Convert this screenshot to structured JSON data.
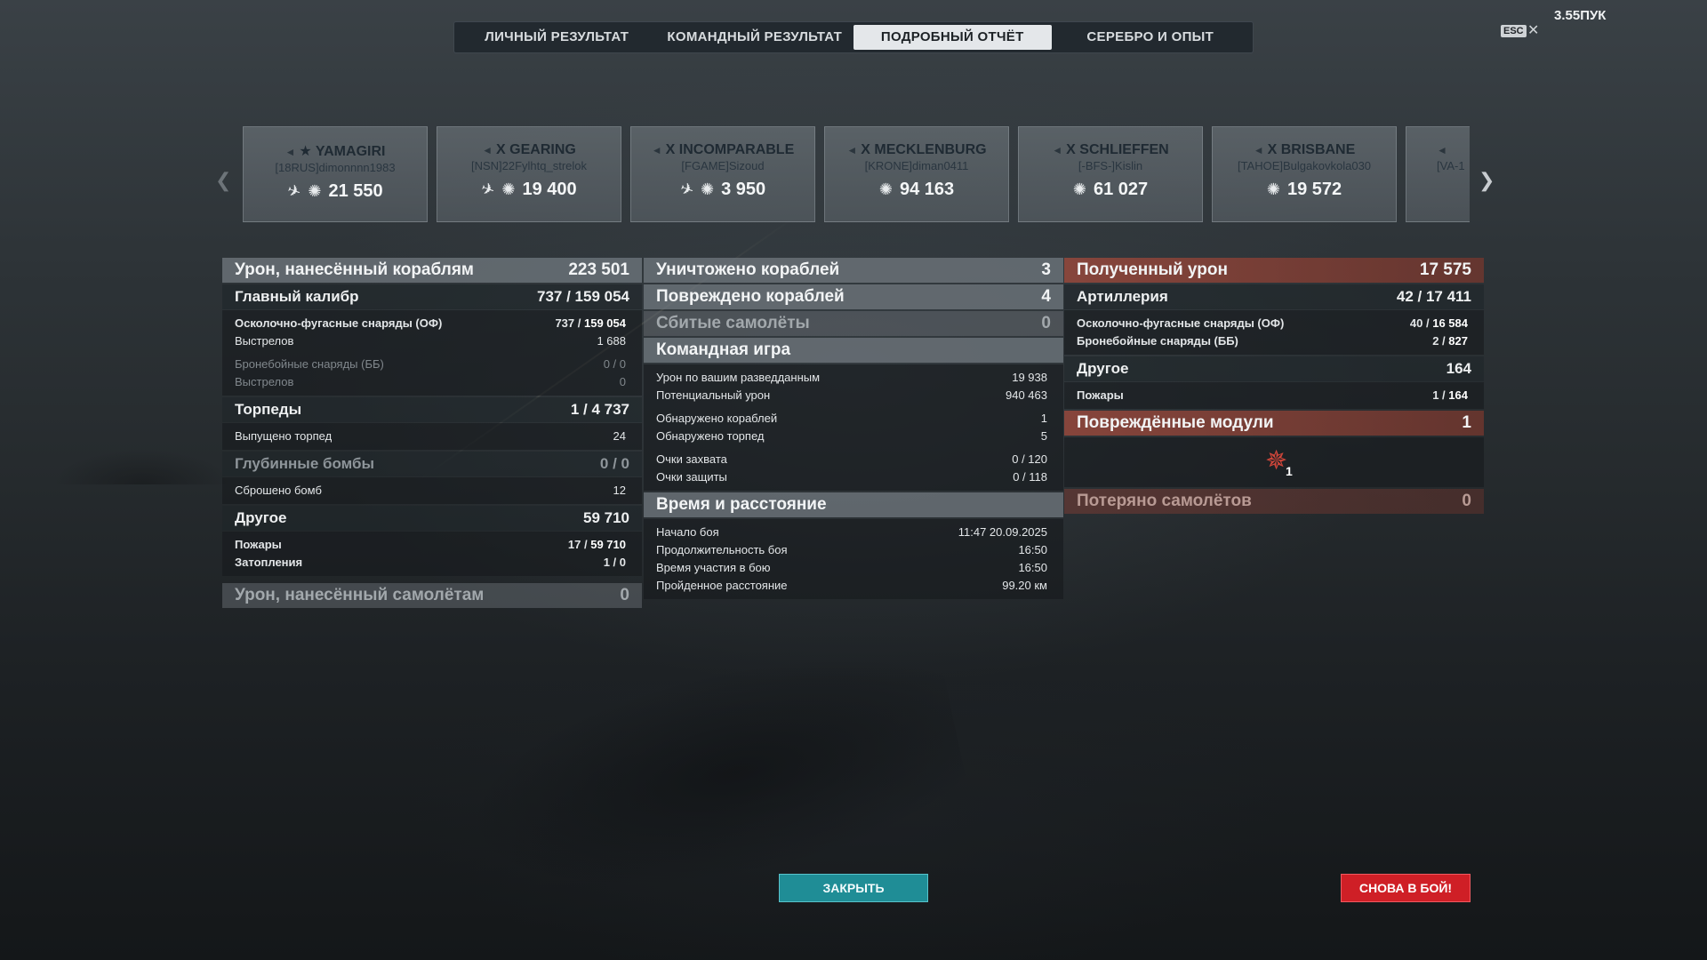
{
  "tabs": [
    "ЛИЧНЫЙ РЕЗУЛЬТАТ",
    "КОМАНДНЫЙ РЕЗУЛЬТАТ",
    "ПОДРОБНЫЙ ОТЧЁТ",
    "СЕРЕБРО И ОПЫТ"
  ],
  "active_tab": "ПОДРОБНЫЙ ОТЧЁТ",
  "clock": "3.55ПУК",
  "esc_label": "ESC",
  "ships": [
    {
      "tier": "★",
      "name": "YAMAGIRI",
      "player": "[18RUS]dimonnnn1983",
      "damage": "21 550",
      "has_plane": true
    },
    {
      "tier": "X",
      "name": "GEARING",
      "player": "[NSN]22Fylhtq_strelok",
      "damage": "19 400",
      "has_plane": true
    },
    {
      "tier": "X",
      "name": "INCOMPARABLE",
      "player": "[FGAME]Sizoud",
      "damage": "3 950",
      "has_plane": true
    },
    {
      "tier": "X",
      "name": "MECKLENBURG",
      "player": "[KRONE]diman0411",
      "damage": "94 163",
      "has_plane": false
    },
    {
      "tier": "X",
      "name": "SCHLIEFFEN",
      "player": "[-BFS-]Kislin",
      "damage": "61 027",
      "has_plane": false
    },
    {
      "tier": "X",
      "name": "BRISBANE",
      "player": "[TAHOE]Bulgakovkola030",
      "damage": "19 572",
      "has_plane": false
    },
    {
      "tier": "",
      "name": "",
      "player": "[VA-1",
      "damage": "",
      "has_plane": false
    }
  ],
  "col1": {
    "dmg_ships": {
      "label": "Урон, нанесённый кораблям",
      "value": "223 501"
    },
    "main_cal": {
      "label": "Главный калибр",
      "value": "737 / 159 054"
    },
    "he": {
      "label": "Осколочно-фугасные снаряды (ОФ)",
      "v1": "737 /",
      "v2": "159 054"
    },
    "he_shots": {
      "label": "Выстрелов",
      "value": "1 688"
    },
    "ap": {
      "label": "Бронебойные снаряды (ББ)",
      "value": "0 / 0"
    },
    "ap_shots": {
      "label": "Выстрелов",
      "value": "0"
    },
    "torps": {
      "label": "Торпеды",
      "value": "1 / 4 737"
    },
    "torps_fired": {
      "label": "Выпущено торпед",
      "value": "24"
    },
    "depth": {
      "label": "Глубинные бомбы",
      "value": "0 / 0"
    },
    "bombs_dropped": {
      "label": "Сброшено бомб",
      "value": "12"
    },
    "other": {
      "label": "Другое",
      "value": "59 710"
    },
    "fires": {
      "label": "Пожары",
      "v1": "17 /",
      "v2": "59 710"
    },
    "floods": {
      "label": "Затопления",
      "value": "1 / 0"
    },
    "dmg_planes": {
      "label": "Урон, нанесённый самолётам",
      "value": "0"
    }
  },
  "col2": {
    "destroyed": {
      "label": "Уничтожено кораблей",
      "value": "3"
    },
    "damaged": {
      "label": "Повреждено кораблей",
      "value": "4"
    },
    "planes_shot": {
      "label": "Сбитые самолёты",
      "value": "0"
    },
    "team": {
      "label": "Командная игра"
    },
    "spot_dmg": {
      "label": "Урон по вашим разведданным",
      "value": "19 938"
    },
    "potential": {
      "label": "Потенциальный урон",
      "value": "940 463"
    },
    "spotted_ships": {
      "label": "Обнаружено кораблей",
      "value": "1"
    },
    "spotted_torps": {
      "label": "Обнаружено торпед",
      "value": "5"
    },
    "capture": {
      "label": "Очки захвата",
      "value": "0 / 120"
    },
    "defense": {
      "label": "Очки защиты",
      "value": "0 / 118"
    },
    "time": {
      "label": "Время и расстояние"
    },
    "start": {
      "label": "Начало боя",
      "value": "11:47  20.09.2025"
    },
    "duration": {
      "label": "Продолжительность боя",
      "value": "16:50"
    },
    "participation": {
      "label": "Время участия в бою",
      "value": "16:50"
    },
    "distance": {
      "label": "Пройденное расстояние",
      "value": "99.20 км"
    }
  },
  "col3": {
    "received": {
      "label": "Полученный урон",
      "value": "17 575"
    },
    "artillery": {
      "label": "Артиллерия",
      "value": "42 / 17 411"
    },
    "he": {
      "label": "Осколочно-фугасные снаряды (ОФ)",
      "v1": "40 /",
      "v2": "16 584"
    },
    "ap": {
      "label": "Бронебойные снаряды (ББ)",
      "v1": "2 /",
      "v2": "827"
    },
    "other": {
      "label": "Другое",
      "value": "164"
    },
    "fires": {
      "label": "Пожары",
      "v1": "1 /",
      "v2": "164"
    },
    "modules": {
      "label": "Повреждённые модули",
      "value": "1"
    },
    "module_count": "1",
    "planes_lost": {
      "label": "Потеряно самолётов",
      "value": "0"
    }
  },
  "buttons": {
    "close": "ЗАКРЫТЬ",
    "battle": "СНОВА В БОЙ!"
  },
  "colors": {
    "accent_teal": "#1f8d96",
    "accent_red": "#cf1f26",
    "received_header": "#96483c"
  }
}
